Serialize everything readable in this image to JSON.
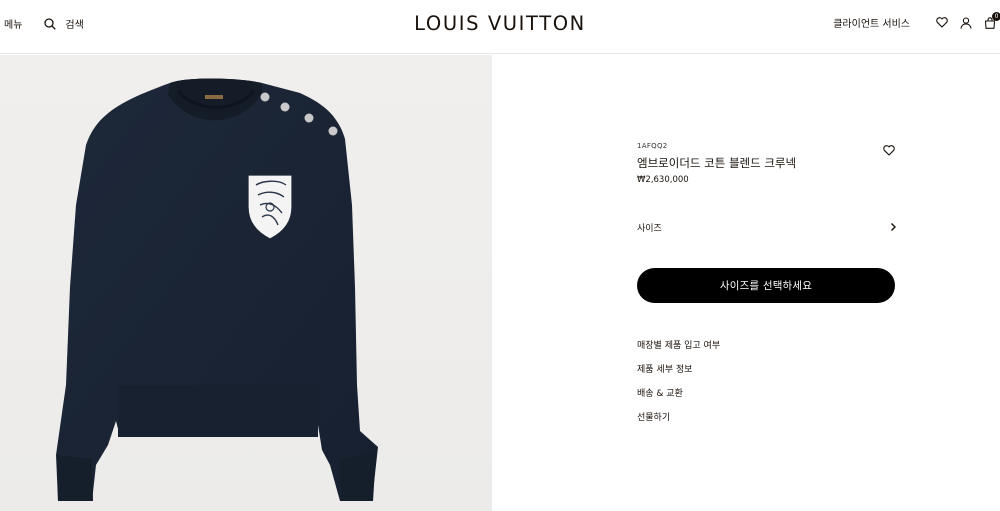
{
  "header": {
    "menu_label": "메뉴",
    "search_label": "검색",
    "logo_text": "LOUIS VUITTON",
    "client_service_label": "클라이언트 서비스",
    "bag_count": "0"
  },
  "product": {
    "sku": "1AFQQ2",
    "name": "엠브로이더드 코튼 블렌드 크루넥",
    "price": "₩2,630,000",
    "size_label": "사이즈",
    "select_size_button": "사이즈를 선택하세요",
    "info_links": [
      "매장별 제품 입고 여부",
      "제품 세부 정보",
      "배송 & 교환",
      "선물하기"
    ]
  },
  "icons": {
    "search": "search-icon",
    "wishlist": "heart-icon",
    "account": "user-icon",
    "bag": "bag-icon",
    "chevron": "chevron-right-icon"
  },
  "colors": {
    "brand_text": "#19110b",
    "button_bg": "#000000",
    "sweater": "#1b2636",
    "gallery_bg": "#efeeec"
  }
}
